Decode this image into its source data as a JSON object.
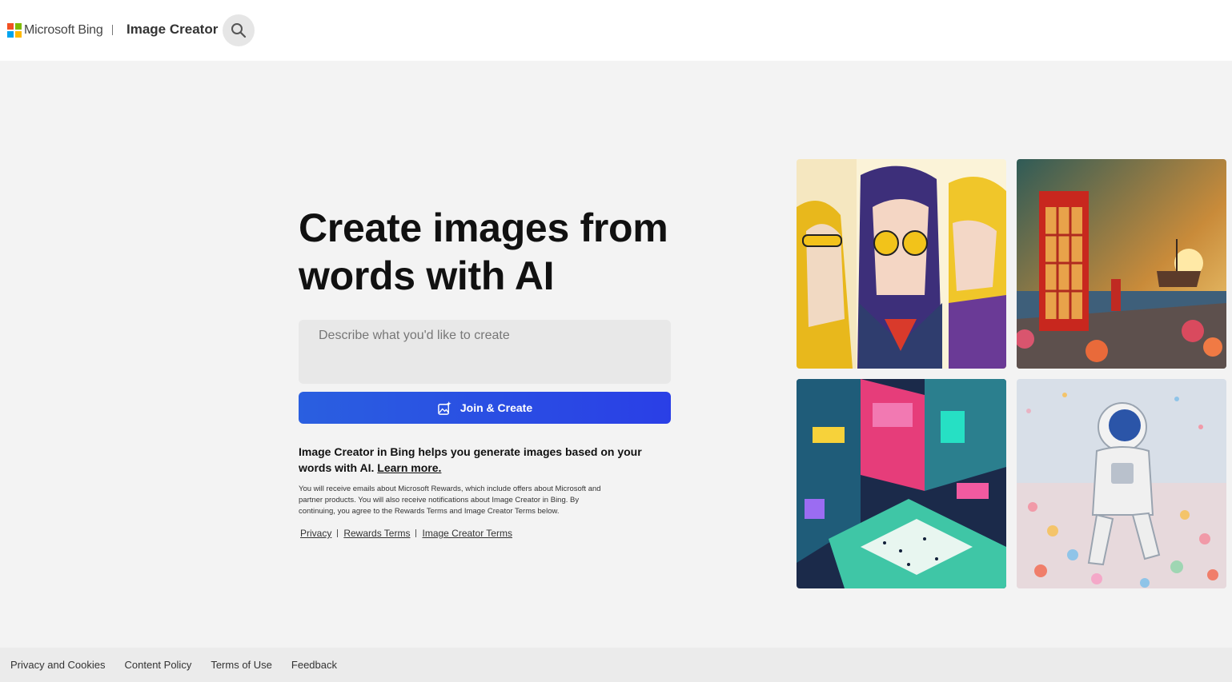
{
  "header": {
    "brand": "Microsoft Bing",
    "product": "Image Creator",
    "search_icon": "search-icon",
    "logo_colors": [
      "#f25022",
      "#7fba00",
      "#00a4ef",
      "#ffb900"
    ]
  },
  "hero": {
    "headline": "Create images from words with AI",
    "prompt_placeholder": "Describe what you'd like to create",
    "create_button": "Join & Create",
    "create_icon": "image-sparkle-icon",
    "description": "Image Creator in Bing helps you generate images based on your words with AI.",
    "learn_more": "Learn more.",
    "fine_print": "You will receive emails about Microsoft Rewards, which include offers about Microsoft and partner products. You will also receive notifications about Image Creator in Bing. By continuing, you agree to the Rewards Terms and Image Creator Terms below.",
    "links": [
      "Privacy",
      "Rewards Terms",
      "Image Creator Terms"
    ]
  },
  "gallery": [
    "anime-girls-image",
    "phone-booth-painting-image",
    "isometric-city-image",
    "astronaut-flowers-image"
  ],
  "footer": {
    "links": [
      "Privacy and Cookies",
      "Content Policy",
      "Terms of Use",
      "Feedback"
    ]
  },
  "colors": {
    "accent": "#2a4fe3",
    "background": "#f3f3f3"
  }
}
